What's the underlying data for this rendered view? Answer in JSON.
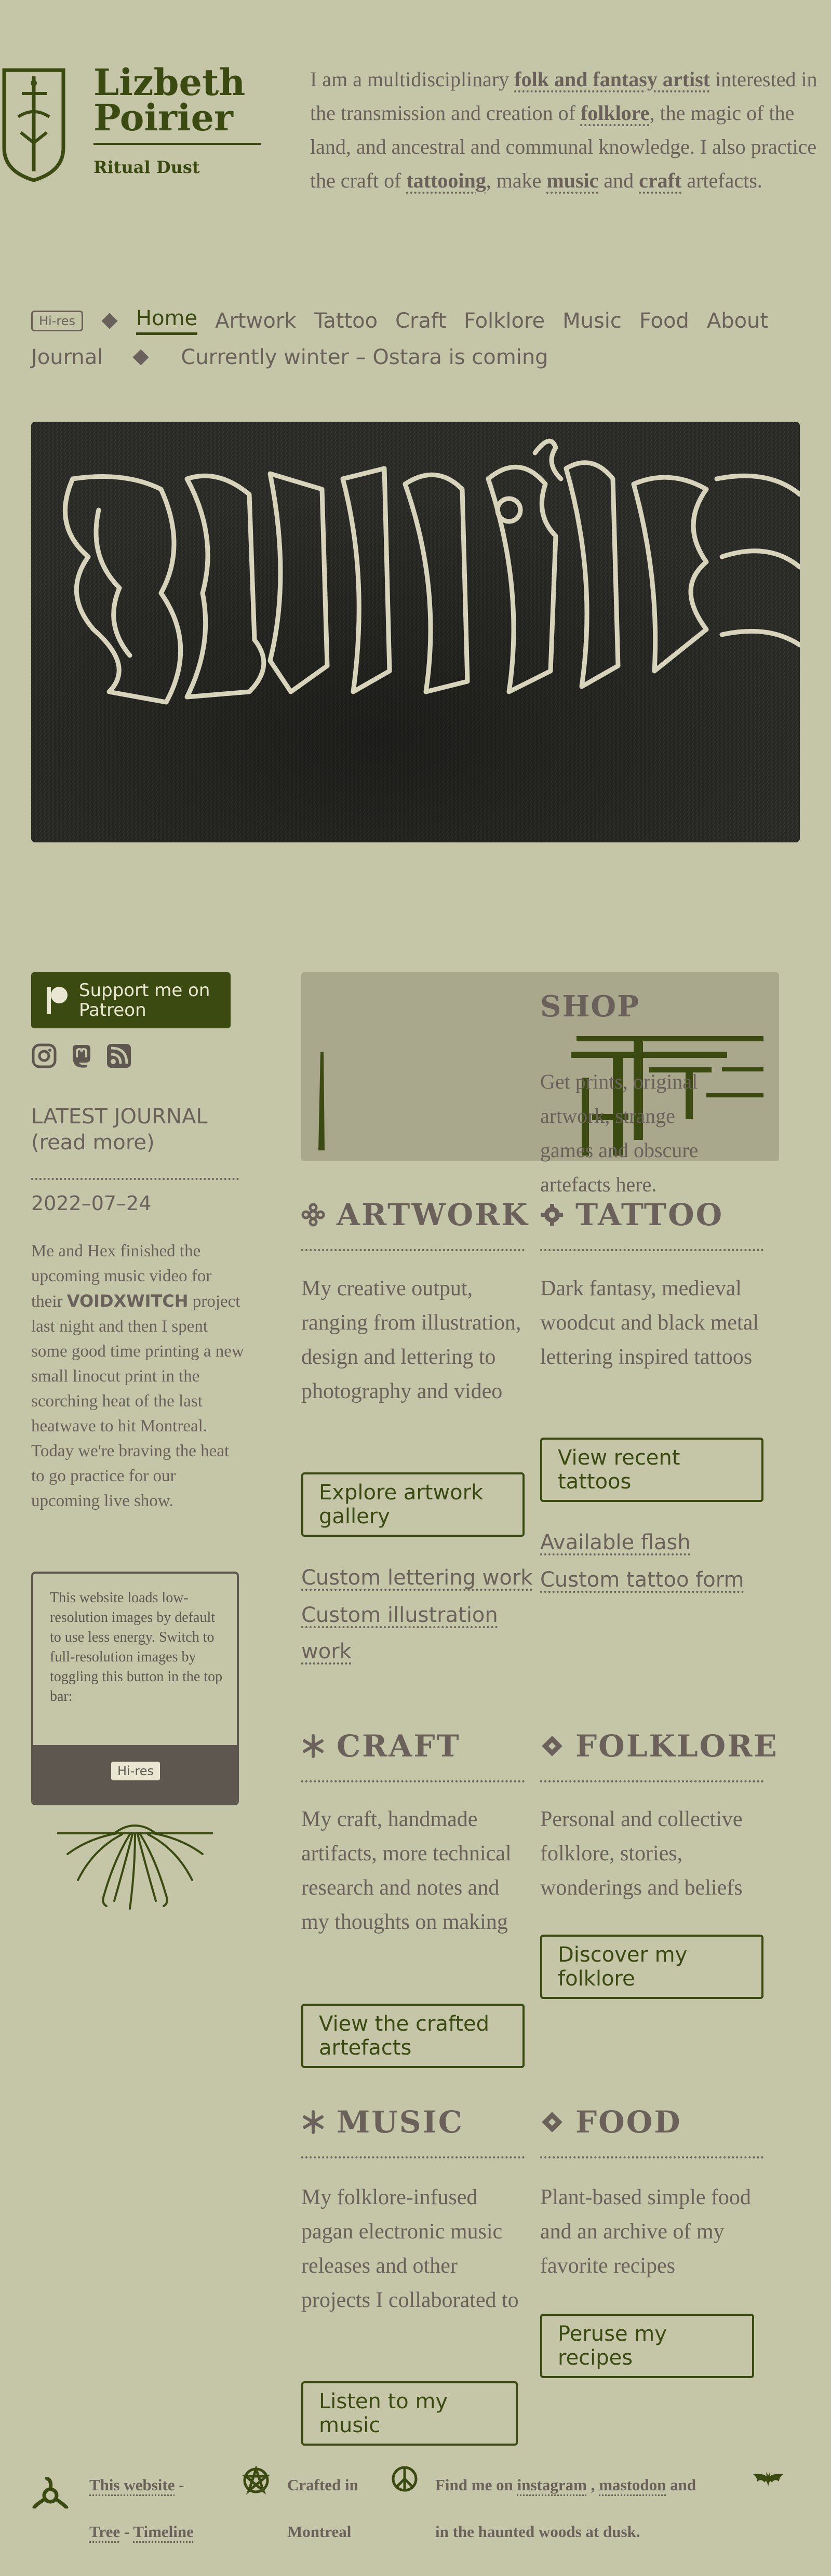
{
  "header": {
    "name_line1": "Lizbeth",
    "name_line2": "Poirier",
    "tagline": "Ritual Dust"
  },
  "intro": {
    "t1": "I am a multidisciplinary ",
    "l1": "folk and fantasy artist",
    "t2": " interested in the transmission and creation of ",
    "l2": "folklore",
    "t3": ", the magic of the land, and ancestral and communal knowledge. I also practice the craft of ",
    "l3": "tattooing",
    "t4": ", make ",
    "l4": "music",
    "t5": " and ",
    "l5": "craft",
    "t6": " artefacts."
  },
  "nav": {
    "hires": "Hi-res",
    "items": [
      "Home",
      "Artwork",
      "Tattoo",
      "Craft",
      "Folklore",
      "Music",
      "Food",
      "About",
      "Journal"
    ],
    "season": "Currently winter – Ostara is coming"
  },
  "sidebar": {
    "patreon_line1": "Support me on",
    "patreon_line2": "Patreon",
    "social_icons": [
      "instagram-icon",
      "mastodon-icon",
      "rss-icon"
    ],
    "journal_heading_1": "LATEST JOURNAL",
    "journal_heading_2": "(read more)",
    "journal_date": "2022–07–24",
    "journal_t1": "Me and Hex finished the upcoming music video for their ",
    "journal_band": "VOIDXWITCH",
    "journal_t2": " project last night and then I spent some good time printing a new small linocut print in the scorching heat of the last heatwave to hit Montreal. Today we're braving the heat to go practice for our upcoming live show.",
    "hires_note": "This website loads low-resolution images by default to use less energy. Switch to full-resolution images by toggling this button in the top bar:",
    "hires_button": "Hi-res"
  },
  "shop": {
    "title": "SHOP",
    "text": "Get prints, original artwork, strange games and obscure artefacts here."
  },
  "sections": {
    "artwork": {
      "title": "ARTWORK",
      "text": "My creative output, ranging from illustration, design and lettering to photography and video",
      "button": "Explore artwork gallery",
      "link1": "Custom lettering work",
      "link2": "Custom illustration work"
    },
    "tattoo": {
      "title": "TATTOO",
      "text": "Dark fantasy, medieval woodcut and black metal lettering inspired tattoos",
      "button": "View recent tattoos",
      "link1": "Available flash",
      "link2": "Custom tattoo form"
    },
    "craft": {
      "title": "CRAFT",
      "text": "My craft, handmade artifacts, more technical research and notes and my thoughts on making",
      "button": "View the crafted artefacts"
    },
    "folklore": {
      "title": "FOLKLORE",
      "text": "Personal and collective folklore, stories, wonderings and beliefs",
      "button": "Discover my folklore"
    },
    "music": {
      "title": "MUSIC",
      "text": "My folklore-infused pagan electronic music releases and other projects I collaborated to",
      "button": "Listen to my music"
    },
    "food": {
      "title": "FOOD",
      "text": "Plant-based simple food and an archive of my favorite recipes",
      "button": "Peruse my recipes"
    }
  },
  "footer": {
    "website_link": "This website",
    "dash": " -",
    "tree_link": "Tree",
    "dash2": " - ",
    "timeline_link": "Timeline",
    "crafted_1": "Crafted in",
    "crafted_2": "Montreal",
    "find_1": "Find me on ",
    "instagram": "instagram",
    "comma": " , ",
    "mastodon": "mastodon",
    "find_2": " and",
    "find_3": "in the haunted woods at dusk."
  },
  "colors": {
    "background": "#c5c5a8",
    "accent": "#3b4a10",
    "text": "#6a625a",
    "shop_panel": "#a9a78c"
  }
}
